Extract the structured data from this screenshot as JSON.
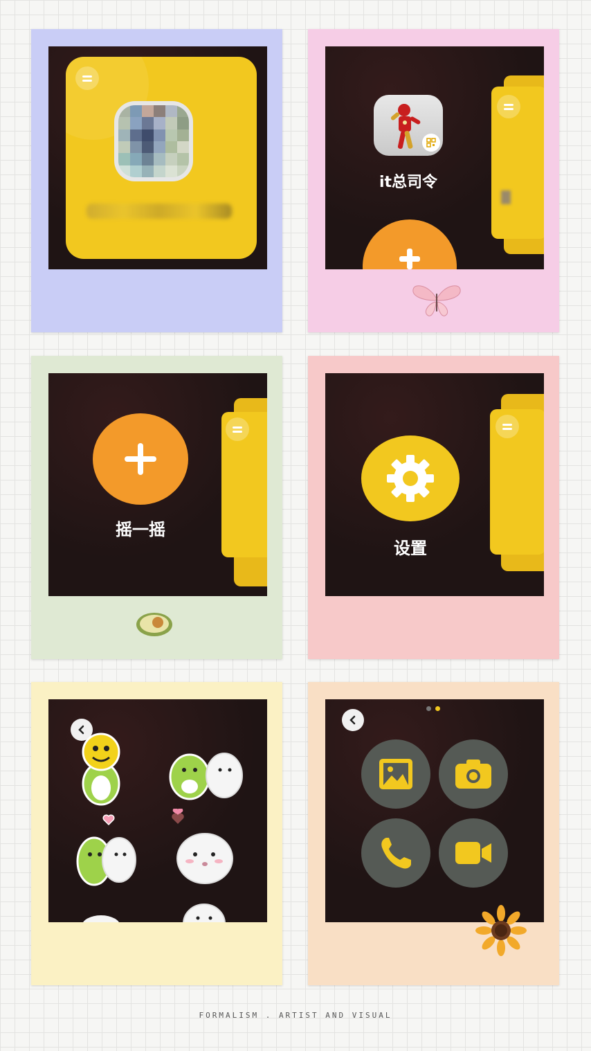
{
  "panels": {
    "panel_2": {
      "contact_name": "it总司令"
    },
    "panel_3": {
      "shake_label": "摇一摇"
    },
    "panel_4": {
      "settings_label": "设置"
    }
  },
  "footer": {
    "text": "FORMALISM . ARTIST AND VISUAL"
  },
  "colors": {
    "frame_1": "#c9cdf6",
    "frame_2": "#f6cde6",
    "frame_3": "#dfe9d3",
    "frame_4": "#f7c9c9",
    "frame_5": "#fbf1c4",
    "frame_6": "#f9dfc5",
    "accent_yellow": "#f2c81f",
    "accent_orange": "#f39a2a",
    "screen_bg": "#1f1414"
  },
  "icons": [
    "menu-icon",
    "qr-code-icon",
    "plus-icon",
    "gear-icon",
    "back-icon",
    "gallery-icon",
    "camera-icon",
    "phone-icon",
    "video-icon"
  ]
}
